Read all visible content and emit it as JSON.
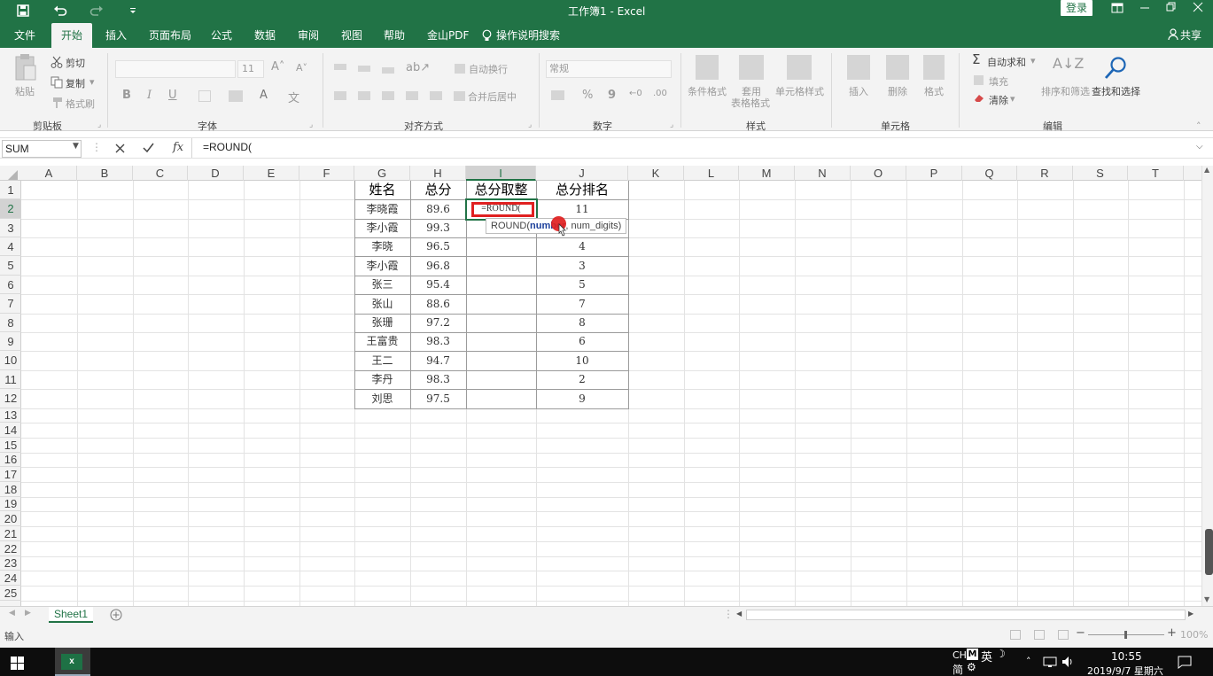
{
  "title_bar": {
    "doc_title": "工作簿1 - Excel",
    "login_label": "登录"
  },
  "tabs": [
    "文件",
    "开始",
    "插入",
    "页面布局",
    "公式",
    "数据",
    "审阅",
    "视图",
    "帮助",
    "金山PDF",
    "操作说明搜索"
  ],
  "share_label": "共享",
  "ribbon": {
    "clipboard": {
      "paste": "粘贴",
      "cut": "剪切",
      "copy": "复制",
      "format_painter": "格式刷",
      "label": "剪贴板"
    },
    "font": {
      "size": "11",
      "bold": "B",
      "italic": "I",
      "underline": "U",
      "label": "字体"
    },
    "alignment": {
      "wrap": "自动换行",
      "merge": "合并后居中",
      "label": "对齐方式"
    },
    "number": {
      "format": "常规",
      "percent": "%",
      "comma": "9",
      "label": "数字"
    },
    "styles": {
      "conditional": "条件格式",
      "table_line1": "套用",
      "table_line2": "表格格式",
      "cell_styles": "单元格样式",
      "label": "样式"
    },
    "cells": {
      "insert": "插入",
      "delete": "删除",
      "format": "格式",
      "label": "单元格"
    },
    "editing": {
      "autosum": "自动求和",
      "fill": "填充",
      "clear": "清除",
      "sort": "排序和筛选",
      "find": "查找和选择",
      "label": "编辑"
    }
  },
  "formula_bar": {
    "name_box": "SUM",
    "formula": "=ROUND(",
    "fx": "fx"
  },
  "columns": [
    "A",
    "B",
    "C",
    "D",
    "E",
    "F",
    "G",
    "H",
    "I",
    "J",
    "K",
    "L",
    "M",
    "N",
    "O",
    "P",
    "Q",
    "R",
    "S",
    "T"
  ],
  "rows": [
    "1",
    "2",
    "3",
    "4",
    "5",
    "6",
    "7",
    "8",
    "9",
    "10",
    "11",
    "12",
    "13",
    "14",
    "15",
    "16",
    "17",
    "18",
    "19",
    "20",
    "21",
    "22",
    "23",
    "24",
    "25"
  ],
  "table": {
    "headers": [
      "姓名",
      "总分",
      "总分取整",
      "总分排名"
    ],
    "rows": [
      {
        "name": "李晓霞",
        "score": "89.6",
        "round": "=ROUND(",
        "rank": "11"
      },
      {
        "name": "李小霞",
        "score": "99.3",
        "round": "",
        "rank": ""
      },
      {
        "name": "李晓",
        "score": "96.5",
        "round": "",
        "rank": "4"
      },
      {
        "name": "李小霞",
        "score": "96.8",
        "round": "",
        "rank": "3"
      },
      {
        "name": "张三",
        "score": "95.4",
        "round": "",
        "rank": "5"
      },
      {
        "name": "张山",
        "score": "88.6",
        "round": "",
        "rank": "7"
      },
      {
        "name": "张珊",
        "score": "97.2",
        "round": "",
        "rank": "8"
      },
      {
        "name": "王富贵",
        "score": "98.3",
        "round": "",
        "rank": "6"
      },
      {
        "name": "王二",
        "score": "94.7",
        "round": "",
        "rank": "10"
      },
      {
        "name": "李丹",
        "score": "98.3",
        "round": "",
        "rank": "2"
      },
      {
        "name": "刘思",
        "score": "97.5",
        "round": "",
        "rank": "9"
      }
    ]
  },
  "tooltip": {
    "fn": "ROUND(",
    "arg1": "number",
    "rest": ", num_digits)"
  },
  "sheet_tab": "Sheet1",
  "status": {
    "mode": "输入",
    "zoom": "100%"
  },
  "taskbar": {
    "ime1": "CH",
    "ime2": "英",
    "ime3": "简",
    "time": "10:55",
    "date": "2019/9/7 星期六"
  },
  "colors": {
    "excel_green": "#217346",
    "selection_red": "#e02020"
  }
}
